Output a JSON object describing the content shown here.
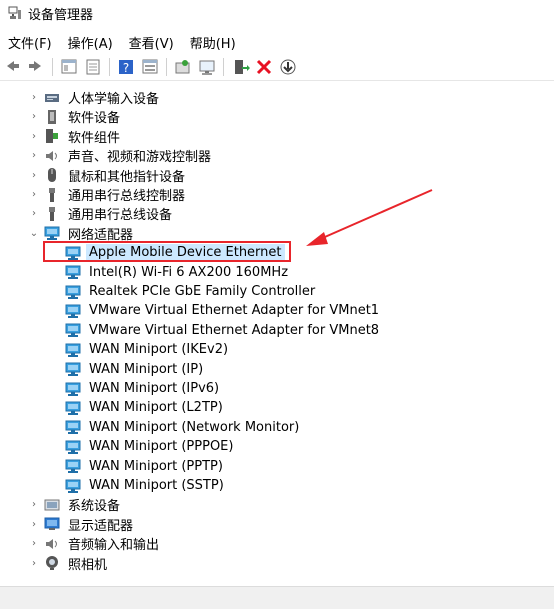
{
  "window": {
    "title": "设备管理器",
    "icon": "device-manager-icon"
  },
  "menu": [
    "文件(F)",
    "操作(A)",
    "查看(V)",
    "帮助(H)"
  ],
  "toolbar": [
    {
      "name": "back-icon"
    },
    {
      "name": "forward-icon"
    },
    {
      "sep": true
    },
    {
      "name": "properties-icon"
    },
    {
      "name": "show-hidden-icon"
    },
    {
      "sep": true
    },
    {
      "name": "help-icon"
    },
    {
      "name": "details-icon"
    },
    {
      "sep": true
    },
    {
      "name": "update-driver-icon"
    },
    {
      "name": "scan-hardware-icon"
    },
    {
      "sep": true
    },
    {
      "name": "enable-device-icon"
    },
    {
      "name": "uninstall-icon"
    },
    {
      "name": "download-icon"
    }
  ],
  "tree": {
    "categories_before": [
      {
        "label": "人体学输入设备",
        "icon": "hid-icon",
        "expanded": false
      },
      {
        "label": "软件设备",
        "icon": "software-device-icon",
        "expanded": false
      },
      {
        "label": "软件组件",
        "icon": "software-component-icon",
        "expanded": false
      },
      {
        "label": "声音、视频和游戏控制器",
        "icon": "sound-icon",
        "expanded": false
      },
      {
        "label": "鼠标和其他指针设备",
        "icon": "mouse-icon",
        "expanded": false
      },
      {
        "label": "通用串行总线控制器",
        "icon": "usb-icon",
        "expanded": false
      },
      {
        "label": "通用串行总线设备",
        "icon": "usb-icon",
        "expanded": false
      }
    ],
    "network": {
      "label": "网络适配器",
      "icon": "network-adapter-icon",
      "expanded": true,
      "children": [
        "Apple Mobile Device Ethernet",
        "Intel(R) Wi-Fi 6 AX200 160MHz",
        "Realtek PCIe GbE Family Controller",
        "VMware Virtual Ethernet Adapter for VMnet1",
        "VMware Virtual Ethernet Adapter for VMnet8",
        "WAN Miniport (IKEv2)",
        "WAN Miniport (IP)",
        "WAN Miniport (IPv6)",
        "WAN Miniport (L2TP)",
        "WAN Miniport (Network Monitor)",
        "WAN Miniport (PPPOE)",
        "WAN Miniport (PPTP)",
        "WAN Miniport (SSTP)"
      ],
      "selected_index": 0
    },
    "categories_after": [
      {
        "label": "系统设备",
        "icon": "system-device-icon",
        "expanded": false
      },
      {
        "label": "显示适配器",
        "icon": "display-adapter-icon",
        "expanded": false
      },
      {
        "label": "音频输入和输出",
        "icon": "audio-io-icon",
        "expanded": false
      },
      {
        "label": "照相机",
        "icon": "camera-icon",
        "expanded": false
      }
    ]
  },
  "annotation": {
    "highlight_color": "#e8252b",
    "selection_color": "#cce8ff"
  }
}
